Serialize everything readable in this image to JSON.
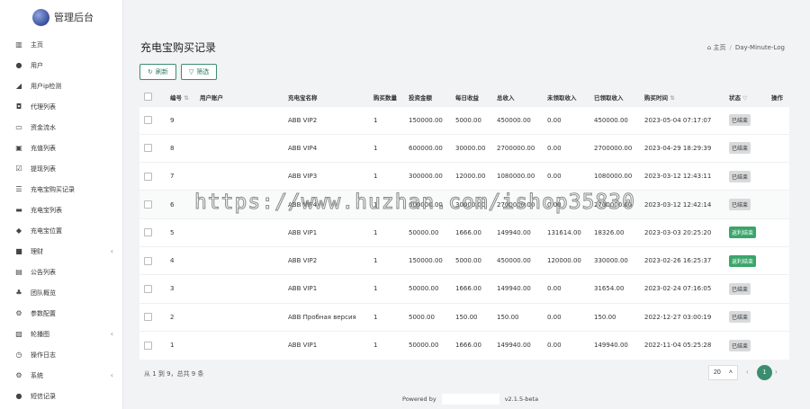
{
  "app": {
    "title": "管理后台"
  },
  "sidebar": {
    "items": [
      {
        "icon": "bar-chart-icon",
        "glyph": "▥",
        "label": "主页"
      },
      {
        "icon": "user-icon",
        "glyph": "●",
        "label": "用户"
      },
      {
        "icon": "line-chart-icon",
        "glyph": "◢",
        "label": "用户ip检测"
      },
      {
        "icon": "agent-icon",
        "glyph": "◘",
        "label": "代理列表"
      },
      {
        "icon": "money-flow-icon",
        "glyph": "▭",
        "label": "资金流水"
      },
      {
        "icon": "recharge-icon",
        "glyph": "▣",
        "label": "充值列表"
      },
      {
        "icon": "withdraw-icon",
        "glyph": "☑",
        "label": "提现列表"
      },
      {
        "icon": "list-icon",
        "glyph": "☰",
        "label": "充电宝购买记录"
      },
      {
        "icon": "power-bank-icon",
        "glyph": "▬",
        "label": "充电宝列表"
      },
      {
        "icon": "location-icon",
        "glyph": "◆",
        "label": "充电宝位置"
      },
      {
        "icon": "finance-icon",
        "glyph": "■",
        "label": "理财",
        "arrow": "‹"
      },
      {
        "icon": "notice-icon",
        "glyph": "▤",
        "label": "公告列表"
      },
      {
        "icon": "team-icon",
        "glyph": "♣",
        "label": "团队概览"
      },
      {
        "icon": "settings-icon",
        "glyph": "⚙",
        "label": "参数配置"
      },
      {
        "icon": "carousel-icon",
        "glyph": "▧",
        "label": "轮播图",
        "arrow": "‹"
      },
      {
        "icon": "clock-icon",
        "glyph": "◷",
        "label": "操作日志"
      },
      {
        "icon": "system-icon",
        "glyph": "⚙",
        "label": "系统",
        "arrow": "‹"
      },
      {
        "icon": "sms-icon",
        "glyph": "●",
        "label": "短信记录"
      }
    ]
  },
  "page": {
    "title": "充电宝购买记录",
    "breadcrumb": {
      "home_icon": "⌂",
      "home": "主页",
      "separator": "/",
      "current": "Day-Minute-Log"
    }
  },
  "toolbar": {
    "refresh_label": "刷新",
    "filter_label": "筛选"
  },
  "table": {
    "columns": [
      "编号",
      "用户账户",
      "充电宝名称",
      "购买数量",
      "投资金额",
      "每日收益",
      "总收入",
      "未领取收入",
      "已领取收入",
      "购买时间",
      "状态",
      "操作"
    ],
    "rows": [
      {
        "id": "9",
        "account": "",
        "name": "ABB VIP2",
        "qty": "1",
        "invest": "150000.00",
        "daily": "5000.00",
        "total": "450000.00",
        "unclaimed": "0.00",
        "claimed": "450000.00",
        "time": "2023-05-04 07:17:07",
        "status": "已结束",
        "status_type": "done"
      },
      {
        "id": "8",
        "account": "",
        "name": "ABB VIP4",
        "qty": "1",
        "invest": "600000.00",
        "daily": "30000.00",
        "total": "2700000.00",
        "unclaimed": "0.00",
        "claimed": "2700000.00",
        "time": "2023-04-29 18:29:39",
        "status": "已结束",
        "status_type": "done"
      },
      {
        "id": "7",
        "account": "",
        "name": "ABB VIP3",
        "qty": "1",
        "invest": "300000.00",
        "daily": "12000.00",
        "total": "1080000.00",
        "unclaimed": "0.00",
        "claimed": "1080000.00",
        "time": "2023-03-12 12:43:11",
        "status": "已结束",
        "status_type": "done"
      },
      {
        "id": "6",
        "account": "",
        "name": "ABB VIP4",
        "qty": "1",
        "invest": "600000.00",
        "daily": "30000.00",
        "total": "2700000.00",
        "unclaimed": "0.00",
        "claimed": "2700000.00",
        "time": "2023-03-12 12:42:14",
        "status": "已结束",
        "status_type": "done"
      },
      {
        "id": "5",
        "account": "",
        "name": "ABB VIP1",
        "qty": "1",
        "invest": "50000.00",
        "daily": "1666.00",
        "total": "149940.00",
        "unclaimed": "131614.00",
        "claimed": "18326.00",
        "time": "2023-03-03 20:25:20",
        "status": "返利结束",
        "status_type": "ok"
      },
      {
        "id": "4",
        "account": "",
        "name": "ABB VIP2",
        "qty": "1",
        "invest": "150000.00",
        "daily": "5000.00",
        "total": "450000.00",
        "unclaimed": "120000.00",
        "claimed": "330000.00",
        "time": "2023-02-26 16:25:37",
        "status": "返利结束",
        "status_type": "ok"
      },
      {
        "id": "3",
        "account": "",
        "name": "ABB VIP1",
        "qty": "1",
        "invest": "50000.00",
        "daily": "1666.00",
        "total": "149940.00",
        "unclaimed": "0.00",
        "claimed": "31654.00",
        "time": "2023-02-24 07:16:05",
        "status": "已结束",
        "status_type": "done"
      },
      {
        "id": "2",
        "account": "",
        "name": "ABB Пробная версия",
        "qty": "1",
        "invest": "5000.00",
        "daily": "150.00",
        "total": "150.00",
        "unclaimed": "0.00",
        "claimed": "150.00",
        "time": "2022-12-27 03:00:19",
        "status": "已结束",
        "status_type": "done"
      },
      {
        "id": "1",
        "account": "",
        "name": "ABB VIP1",
        "qty": "1",
        "invest": "50000.00",
        "daily": "1666.00",
        "total": "149940.00",
        "unclaimed": "0.00",
        "claimed": "149940.00",
        "time": "2022-11-04 05:25:28",
        "status": "已结束",
        "status_type": "done"
      }
    ]
  },
  "pagination": {
    "info": "从 1 到 9，总共 9 条",
    "page_size": "20",
    "current_page": "1"
  },
  "footer": {
    "powered_label": "Powered by",
    "version": "v2.1.5-beta"
  },
  "watermark": "https://www.huzhan.com/ishop35830",
  "colors": {
    "accent": "#3a8e6e",
    "badge_done": "#d8dadc",
    "badge_ok": "#3aa56a"
  }
}
